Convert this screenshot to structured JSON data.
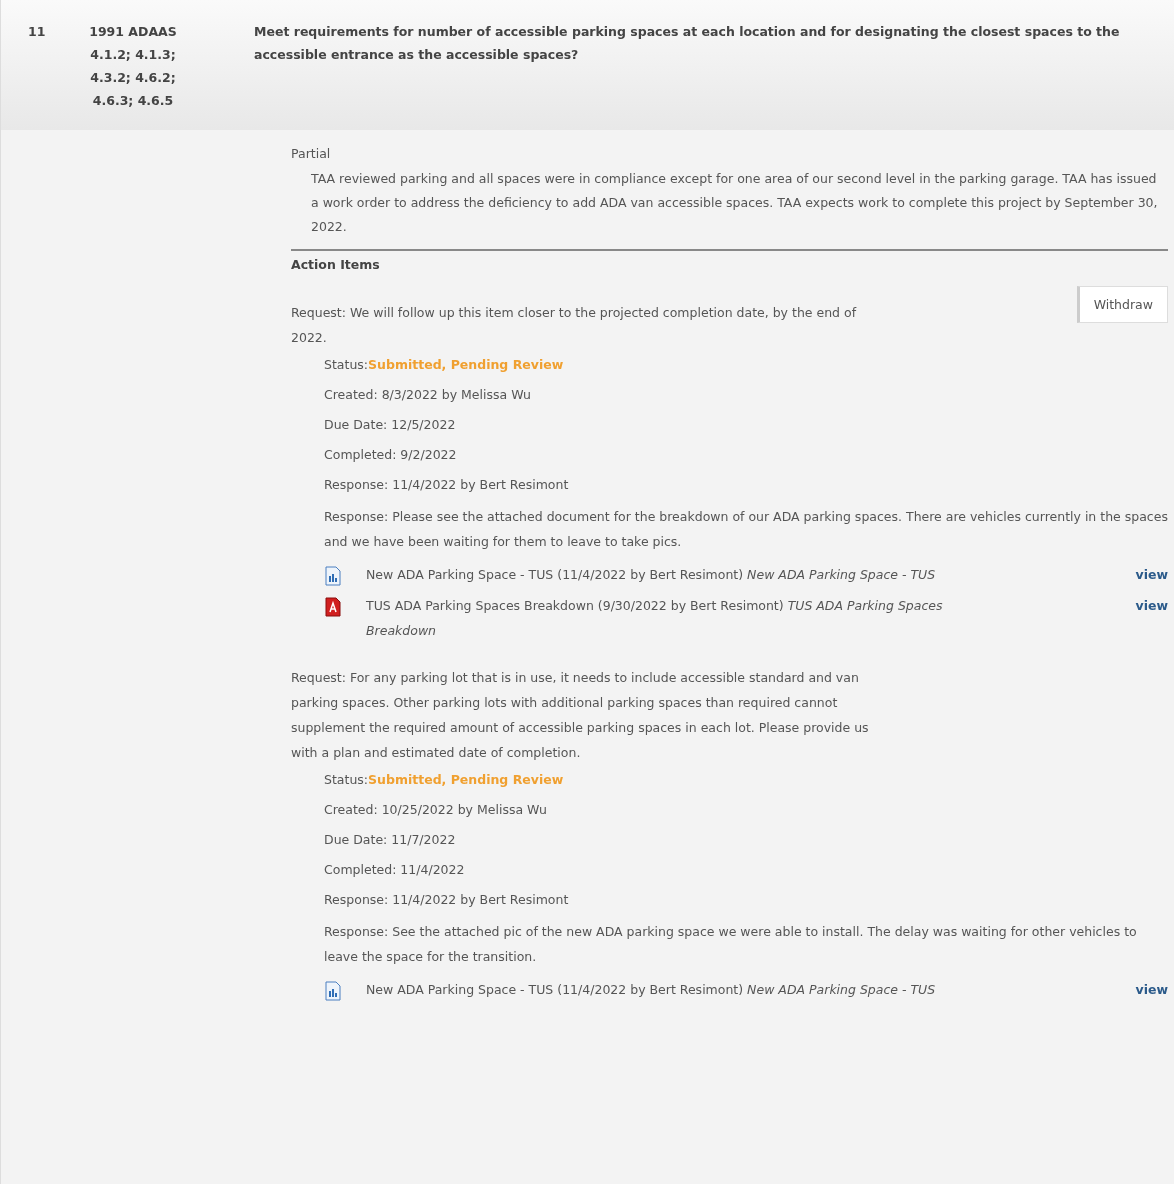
{
  "question": {
    "number": "11",
    "reference": "1991 ADAAS 4.1.2; 4.1.3; 4.3.2; 4.6.2; 4.6.3; 4.6.5",
    "text": "Meet requirements for number of accessible parking spaces at each location and for designating the closest spaces to the accessible entrance as the accessible spaces?"
  },
  "answer": {
    "rating": "Partial",
    "comment": "TAA reviewed parking and all spaces were in compliance except for one area of our second level in the parking garage. TAA has issued a work order to address the deficiency to add ADA van accessible spaces. TAA expects work to complete this project by September 30, 2022."
  },
  "action_items_title": "Action Items",
  "action_items": [
    {
      "request": "Request: We will follow up this item closer to the projected completion date, by the end of 2022.",
      "button": "Withdraw",
      "status_label": "Status:",
      "status": "Submitted, Pending Review",
      "details": [
        "Created: 8/3/2022 by Melissa Wu",
        "Due Date: 12/5/2022",
        "Completed: 9/2/2022",
        "Response: 11/4/2022 by Bert Resimont"
      ],
      "response": "Response: Please see the attached document for the breakdown of our ADA parking spaces. There are vehicles currently in the spaces and we have been waiting for them to leave to take pics.",
      "attachments": [
        {
          "kind": "image",
          "text": "New ADA Parking Space - TUS (11/4/2022 by Bert Resimont) *New ADA Parking Space - TUS*",
          "link": "view"
        },
        {
          "kind": "pdf",
          "text": "TUS ADA Parking Spaces Breakdown (9/30/2022 by Bert Resimont) *TUS ADA Parking Spaces Breakdown*",
          "link": "view"
        }
      ]
    },
    {
      "request": "Request: For any parking lot that is in use, it needs to include accessible standard and van parking spaces. Other parking lots with additional parking spaces than required cannot supplement the required amount of accessible parking spaces in each lot. Please provide us with a plan and estimated date of completion.",
      "status_label": "Status:",
      "status": "Submitted, Pending Review",
      "details": [
        "Created: 10/25/2022 by Melissa Wu",
        "Due Date: 11/7/2022",
        "Completed: 11/4/2022",
        "Response: 11/4/2022 by Bert Resimont"
      ],
      "response": "Response: See the attached pic of the new ADA parking space we were able to install. The delay was waiting for other vehicles to leave the space for the transition.",
      "attachments": [
        {
          "kind": "image",
          "text": "New ADA Parking Space - TUS (11/4/2022 by Bert Resimont) *New ADA Parking Space - TUS*",
          "link": "view"
        }
      ]
    }
  ]
}
